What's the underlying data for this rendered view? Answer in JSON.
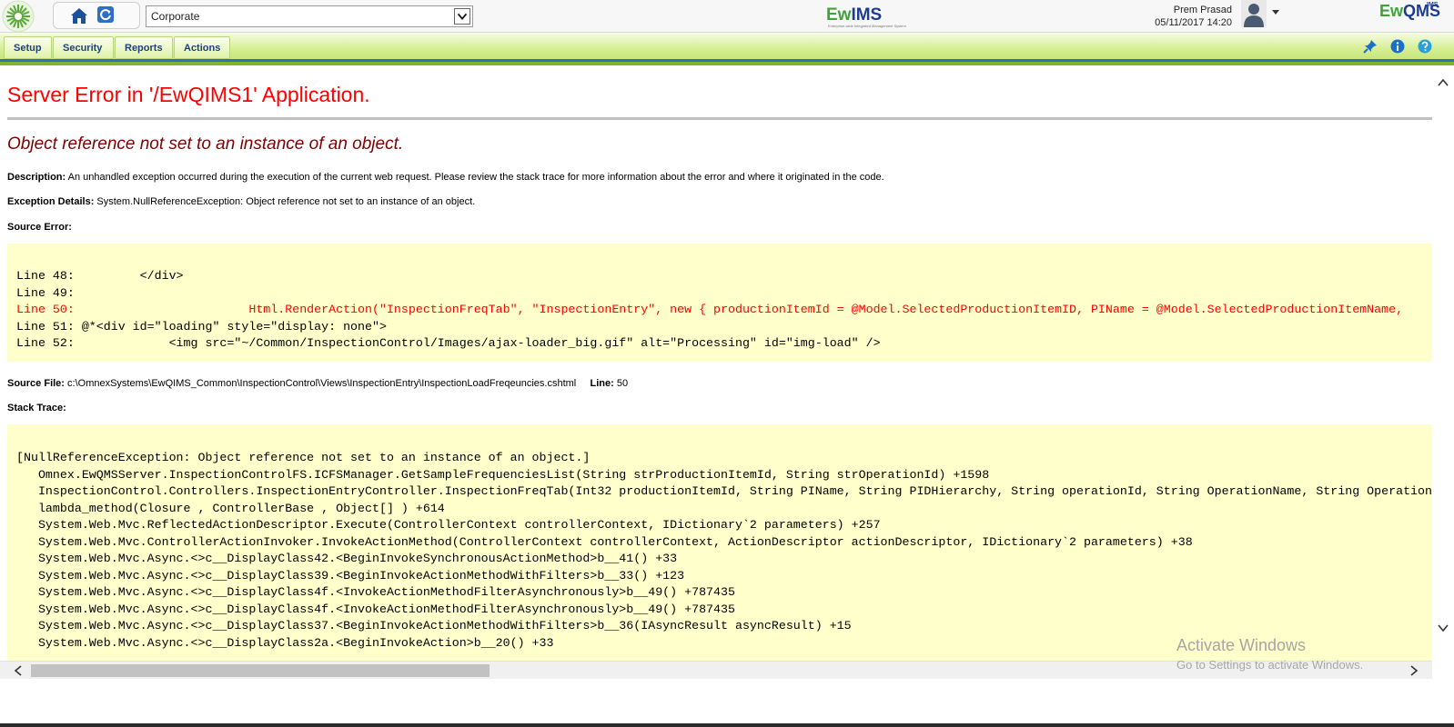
{
  "header": {
    "organization_select_value": "Corporate",
    "center_logo": {
      "ew": "Ew",
      "ims": "IMS",
      "tagline": "Enterprise-wide Integrated Management System"
    },
    "user_name": "Prem Prasad",
    "datetime": "05/11/2017 14:20",
    "right_logo": {
      "ew": "Ew",
      "q": "QMS",
      "ims": "IMS"
    }
  },
  "menu": {
    "items": [
      {
        "label": "Setup"
      },
      {
        "label": "Security"
      },
      {
        "label": "Reports"
      },
      {
        "label": "Actions"
      }
    ]
  },
  "error": {
    "title": "Server Error in '/EwQIMS1' Application.",
    "subtitle": "Object reference not set to an instance of an object.",
    "description_label": "Description:",
    "description_text": " An unhandled exception occurred during the execution of the current web request. Please review the stack trace for more information about the error and where it originated in the code.",
    "exception_label": "Exception Details:",
    "exception_text": " System.NullReferenceException: Object reference not set to an instance of an object.",
    "source_error_label": "Source Error:",
    "source_lines": [
      {
        "text": "Line 48:         </div>",
        "highlight": false
      },
      {
        "text": "Line 49:",
        "highlight": false
      },
      {
        "text": "Line 50:                        Html.RenderAction(\"InspectionFreqTab\", \"InspectionEntry\", new { productionItemId = @Model.SelectedProductionItemID, PIName = @Model.SelectedProductionItemName,",
        "highlight": true
      },
      {
        "text": "Line 51: @*<div id=\"loading\" style=\"display: none\">",
        "highlight": false
      },
      {
        "text": "Line 52:             <img src=\"~/Common/InspectionControl/Images/ajax-loader_big.gif\" alt=\"Processing\" id=\"img-load\" />",
        "highlight": false
      }
    ],
    "source_file_label": "Source File:",
    "source_file_path": " c:\\OmnexSystems\\EwQIMS_Common\\InspectionControl\\Views\\InspectionEntry\\InspectionLoadFreqeuncies.cshtml",
    "line_label": "Line:",
    "line_number": " 50",
    "stack_trace_label": "Stack Trace:",
    "stack_lines": [
      "[NullReferenceException: Object reference not set to an instance of an object.]",
      "   Omnex.EwQMSServer.InspectionControlFS.ICFSManager.GetSampleFrequenciesList(String strProductionItemId, String strOperationId) +1598",
      "   InspectionControl.Controllers.InspectionEntryController.InspectionFreqTab(Int32 productionItemId, String PIName, String PIDHierarchy, String operationId, String OperationName, String OperationId",
      "   lambda_method(Closure , ControllerBase , Object[] ) +614",
      "   System.Web.Mvc.ReflectedActionDescriptor.Execute(ControllerContext controllerContext, IDictionary`2 parameters) +257",
      "   System.Web.Mvc.ControllerActionInvoker.InvokeActionMethod(ControllerContext controllerContext, ActionDescriptor actionDescriptor, IDictionary`2 parameters) +38",
      "   System.Web.Mvc.Async.<>c__DisplayClass42.<BeginInvokeSynchronousActionMethod>b__41() +33",
      "   System.Web.Mvc.Async.<>c__DisplayClass39.<BeginInvokeActionMethodWithFilters>b__33() +123",
      "   System.Web.Mvc.Async.<>c__DisplayClass4f.<InvokeActionMethodFilterAsynchronously>b__49() +787435",
      "   System.Web.Mvc.Async.<>c__DisplayClass4f.<InvokeActionMethodFilterAsynchronously>b__49() +787435",
      "   System.Web.Mvc.Async.<>c__DisplayClass37.<BeginInvokeActionMethodWithFilters>b__36(IAsyncResult asyncResult) +15",
      "   System.Web.Mvc.Async.<>c__DisplayClass2a.<BeginInvokeAction>b__20() +33"
    ]
  },
  "watermark": {
    "line1": "Activate Windows",
    "line2": "Go to Settings to activate Windows."
  },
  "colors": {
    "error_title": "#ff0000",
    "error_subtitle": "#800000",
    "code_background": "#ffffcc",
    "menu_text": "#1f3f7e",
    "menu_bottom_line": "#2f6fb8"
  }
}
